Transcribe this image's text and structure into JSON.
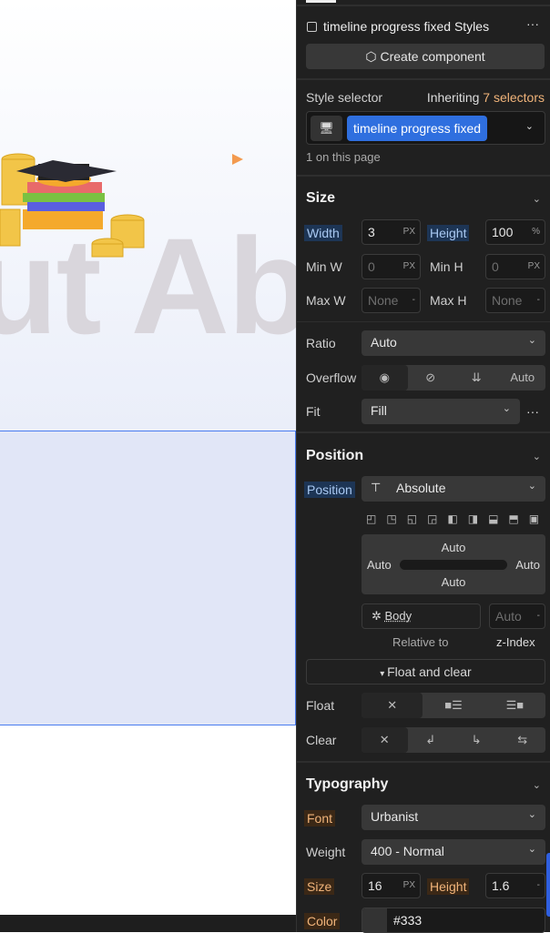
{
  "canvas": {
    "hero_text": "ut Ab"
  },
  "panel": {
    "header": {
      "title": "timeline progress fixed Styles",
      "more": "···",
      "create_component": "Create component"
    },
    "selector": {
      "label": "Style selector",
      "inheriting": "Inheriting",
      "inheriting_count": "7 selectors",
      "class_name": "timeline progress fixed",
      "count_text": "1 on this page"
    },
    "size": {
      "title": "Size",
      "width_label": "Width",
      "width": "3",
      "width_unit": "PX",
      "height_label": "Height",
      "height": "100",
      "height_unit": "%",
      "minw_label": "Min W",
      "minw": "0",
      "minw_unit": "PX",
      "minh_label": "Min H",
      "minh": "0",
      "minh_unit": "PX",
      "maxw_label": "Max W",
      "maxw": "None",
      "maxw_unit": "-",
      "maxh_label": "Max H",
      "maxh": "None",
      "maxh_unit": "-",
      "ratio_label": "Ratio",
      "ratio": "Auto",
      "overflow_label": "Overflow",
      "overflow_auto": "Auto",
      "fit_label": "Fit",
      "fit": "Fill",
      "fit_more": "···"
    },
    "position": {
      "title": "Position",
      "label": "Position",
      "value": "Absolute",
      "top": "Auto",
      "left": "Auto",
      "right": "Auto",
      "bottom": "Auto",
      "relative_value": "Body",
      "zindex": "Auto",
      "zindex_unit": "-",
      "relative_label": "Relative to",
      "zindex_label": "z-Index",
      "float_clear": "Float and clear",
      "float_label": "Float",
      "clear_label": "Clear"
    },
    "typography": {
      "title": "Typography",
      "font_label": "Font",
      "font": "Urbanist",
      "weight_label": "Weight",
      "weight": "400 - Normal",
      "size_label": "Size",
      "size": "16",
      "size_unit": "PX",
      "height_label": "Height",
      "height": "1.6",
      "height_unit": "-",
      "color_label": "Color",
      "color": "#333"
    }
  },
  "colors": {
    "accent": "#2f6fdf",
    "orange": "#f1b47a",
    "selection": "#4a7cf0"
  }
}
